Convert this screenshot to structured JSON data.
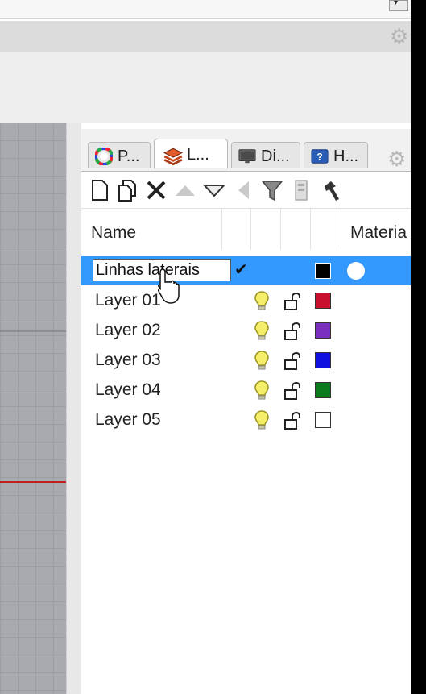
{
  "top_dropdown": {
    "arrow": "▾"
  },
  "panel": {
    "tabs": [
      {
        "label": "P...",
        "icon": "properties-color-wheel-icon"
      },
      {
        "label": "L...",
        "icon": "layers-icon"
      },
      {
        "label": "Di...",
        "icon": "display-monitor-icon"
      },
      {
        "label": "H...",
        "icon": "help-icon"
      }
    ],
    "toolbar": [
      "new-layer-icon",
      "new-sublayer-icon",
      "delete-icon",
      "move-up-icon",
      "move-down-icon",
      "move-out-icon",
      "filter-icon",
      "layer-states-icon",
      "tools-hammer-icon"
    ],
    "columns": {
      "name": "Name",
      "material": "Materia"
    },
    "editing_value": "Linhas laterais",
    "current_mark": "✔",
    "layers": [
      {
        "name": "Layer 01",
        "color": "#c8102e"
      },
      {
        "name": "Layer 02",
        "color": "#7b2fbe"
      },
      {
        "name": "Layer 03",
        "color": "#1010e0"
      },
      {
        "name": "Layer 04",
        "color": "#0a7a1a"
      },
      {
        "name": "Layer 05",
        "color": "#ffffff"
      }
    ],
    "selected_layer_color": "#000000",
    "selection_color": "#3399ff"
  }
}
